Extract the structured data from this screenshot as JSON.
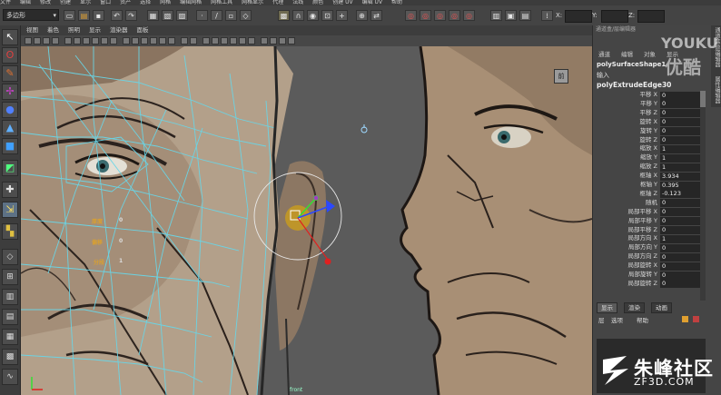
{
  "menubar": {
    "items": [
      "文件",
      "编辑",
      "修改",
      "创建",
      "显示",
      "窗口",
      "资产",
      "选择",
      "网格",
      "编辑网格",
      "网格工具",
      "网格显示",
      "代理",
      "法线",
      "颜色",
      "创建 UV",
      "编辑 UV",
      "帮助"
    ]
  },
  "statusline": {
    "mode_select": "多边形",
    "chevron": "▾",
    "coord_labels": {
      "x": "X:",
      "y": "Y:",
      "z": "Z:"
    }
  },
  "toolbox": {
    "tool_icons": [
      "select-arrow-icon",
      "lasso-icon",
      "paint-select-icon",
      "move-icon",
      "rotate-icon",
      "scale-icon",
      "universal-manip-icon",
      "soft-mod-icon",
      "show-manip-icon"
    ]
  },
  "viewport": {
    "menu_items": [
      "视图",
      "着色",
      "照明",
      "显示",
      "渲染器",
      "面板"
    ],
    "view_cube_label": "前",
    "channel_labels": [
      {
        "text": "厚度",
        "value": "0"
      },
      {
        "text": "偏移",
        "value": "0"
      },
      {
        "text": "分段",
        "value": "1"
      }
    ],
    "bottom_label": "front"
  },
  "watermarks": {
    "youku_en": "YOUKU",
    "youku_cn": "优酷",
    "zhufeng_cn": "朱峰社区",
    "zhufeng_url": "ZF3D.COM"
  },
  "panel": {
    "title": "通道盒/层编辑器",
    "tabs": [
      "通道",
      "编辑",
      "对象",
      "显示"
    ],
    "shape_name": "polySurfaceShape1",
    "input_label": "输入",
    "node_name": "polyExtrudeEdge30",
    "side_tabs": [
      "通道盒/层编辑器",
      "属性编辑器"
    ],
    "attributes": [
      {
        "name": "平移 X",
        "value": "0"
      },
      {
        "name": "平移 Y",
        "value": "0"
      },
      {
        "name": "平移 Z",
        "value": "0"
      },
      {
        "name": "旋转 X",
        "value": "0"
      },
      {
        "name": "旋转 Y",
        "value": "0"
      },
      {
        "name": "旋转 Z",
        "value": "0"
      },
      {
        "name": "缩放 X",
        "value": "1"
      },
      {
        "name": "缩放 Y",
        "value": "1"
      },
      {
        "name": "缩放 Z",
        "value": "1"
      },
      {
        "name": "枢轴 X",
        "value": "3.934"
      },
      {
        "name": "枢轴 Y",
        "value": "0.395"
      },
      {
        "name": "枢轴 Z",
        "value": "-0.123"
      },
      {
        "name": "随机",
        "value": "0"
      },
      {
        "name": "局部平移 X",
        "value": "0"
      },
      {
        "name": "局部平移 Y",
        "value": "0"
      },
      {
        "name": "局部平移 Z",
        "value": "0"
      },
      {
        "name": "局部方向 X",
        "value": "1"
      },
      {
        "name": "局部方向 Y",
        "value": "0"
      },
      {
        "name": "局部方向 Z",
        "value": "0"
      },
      {
        "name": "局部旋转 X",
        "value": "0"
      },
      {
        "name": "局部旋转 Y",
        "value": "0"
      },
      {
        "name": "局部旋转 Z",
        "value": "0"
      }
    ],
    "layer_tabs": [
      "显示",
      "渲染",
      "动画"
    ],
    "layer_menu": [
      "层",
      "选项",
      "帮助"
    ]
  }
}
